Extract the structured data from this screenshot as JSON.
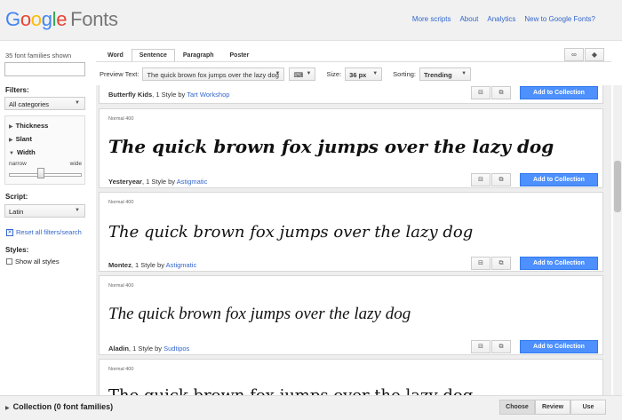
{
  "header": {
    "logo_g1": "G",
    "logo_g2": "o",
    "logo_g3": "o",
    "logo_g4": "g",
    "logo_g5": "l",
    "logo_g6": "e",
    "logo_fonts": "Fonts",
    "links": [
      "More scripts",
      "About",
      "Analytics",
      "New to Google Fonts?"
    ]
  },
  "sidebar": {
    "count": "35 font families shown",
    "filters_label": "Filters:",
    "category": "All categories",
    "thickness": "Thickness",
    "slant": "Slant",
    "width": "Width",
    "narrow": "narrow",
    "wide": "wide",
    "script_label": "Script:",
    "script": "Latin",
    "reset": "Reset all filters/search",
    "styles_label": "Styles:",
    "show_all": "Show all styles"
  },
  "toolbar": {
    "tabs": [
      "Word",
      "Sentence",
      "Paragraph",
      "Poster"
    ],
    "preview_label": "Preview Text:",
    "preview_text": "The quick brown fox jumps over the lazy dog",
    "size_label": "Size:",
    "size": "36 px",
    "sorting_label": "Sorting:",
    "sorting": "Trending"
  },
  "cards": [
    {
      "font": "Butterfly Kids",
      "styles": ", 1 Style by ",
      "author": "Tart Workshop",
      "add": "Add to Collection"
    },
    {
      "style": "Normal 400",
      "sample": "The quick brown fox jumps over the lazy dog",
      "font": "Yesteryear",
      "styles": ", 1 Style by ",
      "author": "Astigmatic",
      "add": "Add to Collection"
    },
    {
      "style": "Normal 400",
      "sample": "The quick brown fox jumps over the lazy dog",
      "font": "Montez",
      "styles": ", 1 Style by ",
      "author": "Astigmatic",
      "add": "Add to Collection"
    },
    {
      "style": "Normal 400",
      "sample": "The quick brown fox jumps over the lazy dog",
      "font": "Aladin",
      "styles": ", 1 Style by ",
      "author": "Sudtipos",
      "add": "Add to Collection"
    },
    {
      "style": "Normal 400",
      "sample": "The quick brown fox jumps over the lazy dog"
    }
  ],
  "footer": {
    "collection": "Collection (0 font families)",
    "buttons": [
      "Choose",
      "Review",
      "Use"
    ]
  }
}
